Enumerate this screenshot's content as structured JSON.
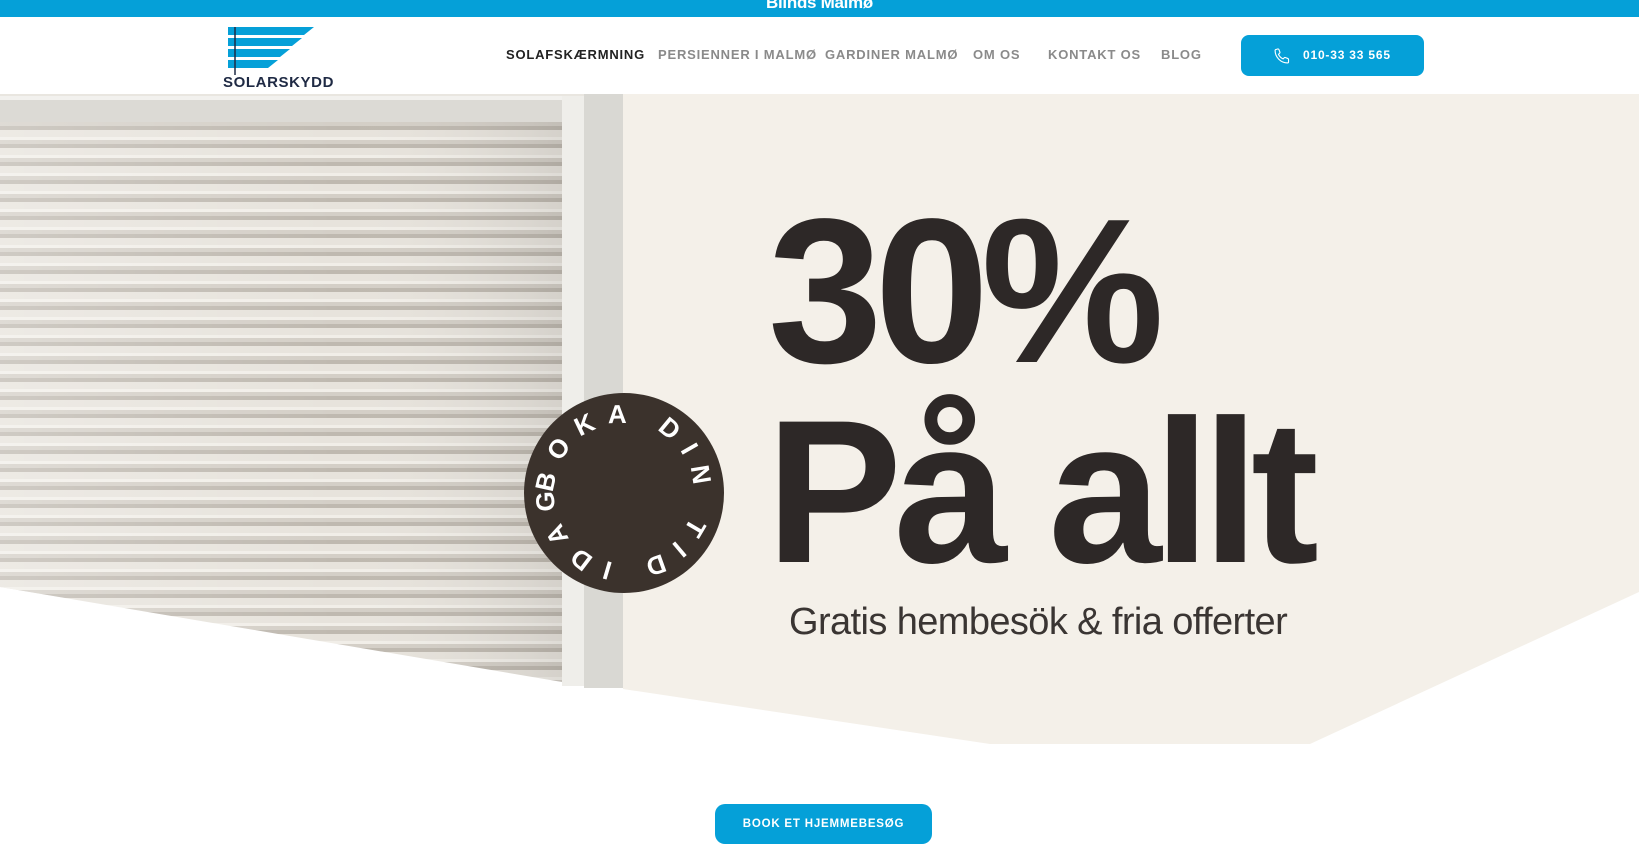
{
  "topbar": {
    "text": "Blinds Malmø"
  },
  "header": {
    "logo_text": "SOLARSKYDD",
    "nav": [
      {
        "label": "SOLAFSKÆRMNING",
        "active": true
      },
      {
        "label": "PERSIENNER I MALMØ",
        "active": false
      },
      {
        "label": "GARDINER MALMØ",
        "active": false
      },
      {
        "label": "OM OS",
        "active": false
      },
      {
        "label": "KONTAKT OS",
        "active": false
      },
      {
        "label": "BLOG",
        "active": false
      }
    ],
    "phone": {
      "label": "010-33 33 565",
      "icon": "phone-icon"
    }
  },
  "hero": {
    "badge_text": "BOKA DIN TID IDAG",
    "headline_percent": "30%",
    "headline_text": "På allt",
    "subline": "Gratis hembesök & fria offerter",
    "cta_label": "BOOK ET HJEMMEBESØG"
  },
  "colors": {
    "brand": "#05a0d8",
    "cream": "#f4f0e9",
    "dark_text": "#2d2827",
    "badge": "#3b322c"
  }
}
